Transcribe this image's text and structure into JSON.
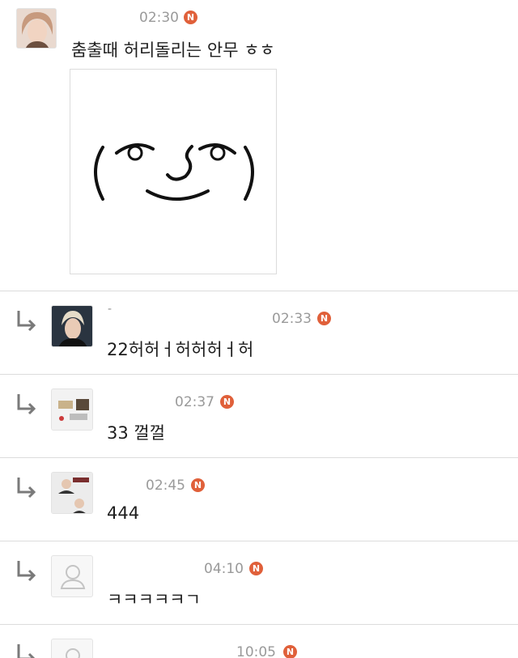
{
  "main_comment": {
    "time": "02:30",
    "badge": "N",
    "text": "춤출때 허리돌리는 안무 ㅎㅎ",
    "sticker_text": "( ͡° ͜ʖ ͡°)"
  },
  "replies": [
    {
      "time": "02:33",
      "badge": "N",
      "text": "22허허ㅓ허허허ㅓ허",
      "prefix": "-"
    },
    {
      "time": "02:37",
      "badge": "N",
      "text": "33 껄껄"
    },
    {
      "time": "02:45",
      "badge": "N",
      "text": "444"
    },
    {
      "time": "04:10",
      "badge": "N",
      "text": "ㅋㅋㅋㅋㅋㄱ"
    },
    {
      "time": "10:05",
      "badge": "N",
      "text": ""
    }
  ],
  "icons": {
    "reply": "reply-arrow-icon",
    "new": "new-badge-icon",
    "default_avatar": "default-profile-icon"
  },
  "colors": {
    "badge": "#e0603a",
    "time": "#9a9a9a",
    "divider": "#dcdcdc",
    "reply_arrow": "#7a7a7a"
  }
}
